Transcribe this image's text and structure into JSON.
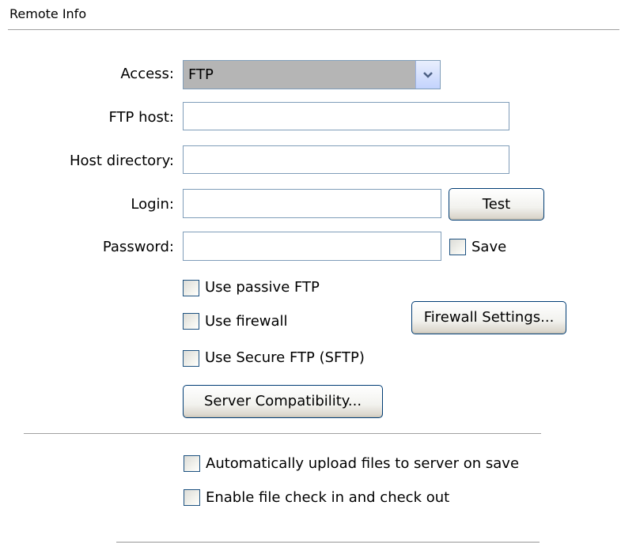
{
  "section": {
    "title": "Remote Info"
  },
  "access": {
    "label": "Access:",
    "value": "FTP"
  },
  "ftp_host": {
    "label": "FTP host:",
    "value": ""
  },
  "host_directory": {
    "label": "Host directory:",
    "value": ""
  },
  "login": {
    "label": "Login:",
    "value": "",
    "test_button": "Test"
  },
  "password": {
    "label": "Password:",
    "value": "",
    "save_label": "Save",
    "save_checked": false
  },
  "options": {
    "passive_ftp": {
      "label": "Use passive FTP",
      "checked": false
    },
    "use_firewall": {
      "label": "Use firewall",
      "checked": false
    },
    "secure_ftp": {
      "label": "Use Secure FTP (SFTP)",
      "checked": false
    },
    "firewall_settings_button": "Firewall Settings...",
    "server_compat_button": "Server Compatibility..."
  },
  "bottom_options": {
    "auto_upload": {
      "label": "Automatically upload files to server on save",
      "checked": false
    },
    "check_in_out": {
      "label": "Enable file check in and check out",
      "checked": false
    }
  },
  "icons": {
    "dropdown": "chevron-down-icon"
  }
}
